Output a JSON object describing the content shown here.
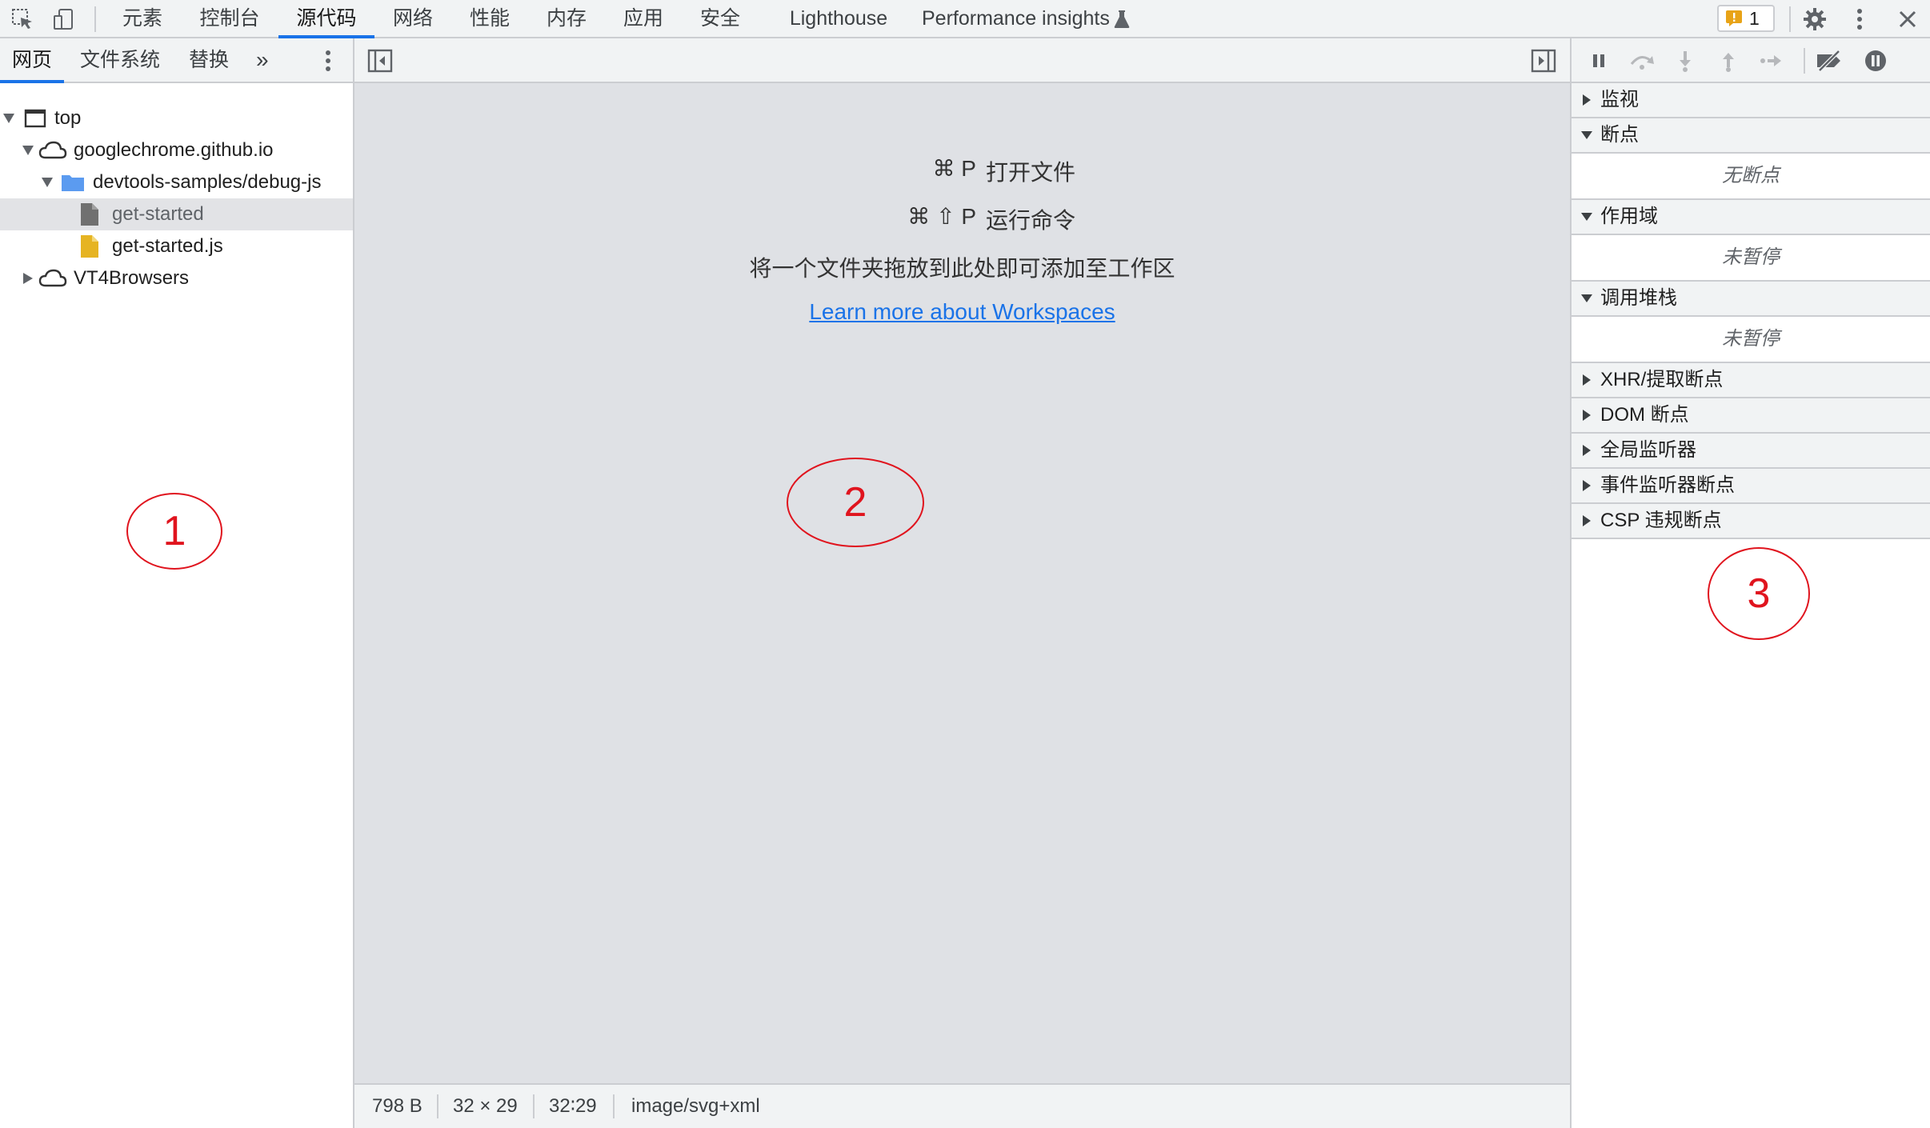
{
  "toolbar": {
    "tabs": [
      "元素",
      "控制台",
      "源代码",
      "网络",
      "性能",
      "内存",
      "应用",
      "安全",
      "Lighthouse",
      "Performance insights"
    ],
    "active_tab": "源代码",
    "issues_count": "1",
    "icons": [
      "inspect-element-icon",
      "device-toolbar-icon",
      "flask-icon",
      "issues-icon",
      "settings-icon",
      "more-icon",
      "close-icon"
    ]
  },
  "left_pane": {
    "tabs": [
      "网页",
      "文件系统",
      "替换"
    ],
    "more_tabs_symbol": "»",
    "tree": [
      {
        "label": "top",
        "icon": "frame-icon",
        "expanded": true
      },
      {
        "label": "googlechrome.github.io",
        "icon": "cloud-icon",
        "expanded": true
      },
      {
        "label": "devtools-samples/debug-js",
        "icon": "folder-icon",
        "expanded": true
      },
      {
        "label": "get-started",
        "icon": "document-icon",
        "selected": true
      },
      {
        "label": "get-started.js",
        "icon": "js-file-icon"
      },
      {
        "label": "VT4Browsers",
        "icon": "cloud-icon",
        "expanded": false
      }
    ]
  },
  "center": {
    "shortcuts": [
      {
        "keys": "⌘ P",
        "action": "打开文件"
      },
      {
        "keys": "⌘ ⇧ P",
        "action": "运行命令"
      }
    ],
    "drop_hint": "将一个文件夹拖放到此处即可添加至工作区",
    "workspaces_link": "Learn more about Workspaces",
    "status": {
      "size": "798 B",
      "dimensions": "32 × 29",
      "ratio": "32∶29",
      "mime": "image/svg+xml"
    }
  },
  "right_pane": {
    "debug_icons": [
      "pause-icon",
      "step-over-icon",
      "step-into-icon",
      "step-out-icon",
      "step-icon",
      "deactivate-breakpoints-icon",
      "pause-on-exceptions-icon"
    ],
    "sections": [
      {
        "label": "监视",
        "expanded": false
      },
      {
        "label": "断点",
        "expanded": true,
        "body": "无断点"
      },
      {
        "label": "作用域",
        "expanded": true,
        "body": "未暂停"
      },
      {
        "label": "调用堆栈",
        "expanded": true,
        "body": "未暂停"
      },
      {
        "label": "XHR/提取断点",
        "expanded": false
      },
      {
        "label": "DOM 断点",
        "expanded": false
      },
      {
        "label": "全局监听器",
        "expanded": false
      },
      {
        "label": "事件监听器断点",
        "expanded": false
      },
      {
        "label": "CSP 违规断点",
        "expanded": false
      }
    ]
  },
  "annotations": [
    "1",
    "2",
    "3"
  ],
  "colors": {
    "accent": "#1a73e8",
    "annotation": "#e0141e",
    "warning_badge": "#e8a317",
    "folder": "#5b9bf0",
    "js_file": "#e6b422"
  }
}
